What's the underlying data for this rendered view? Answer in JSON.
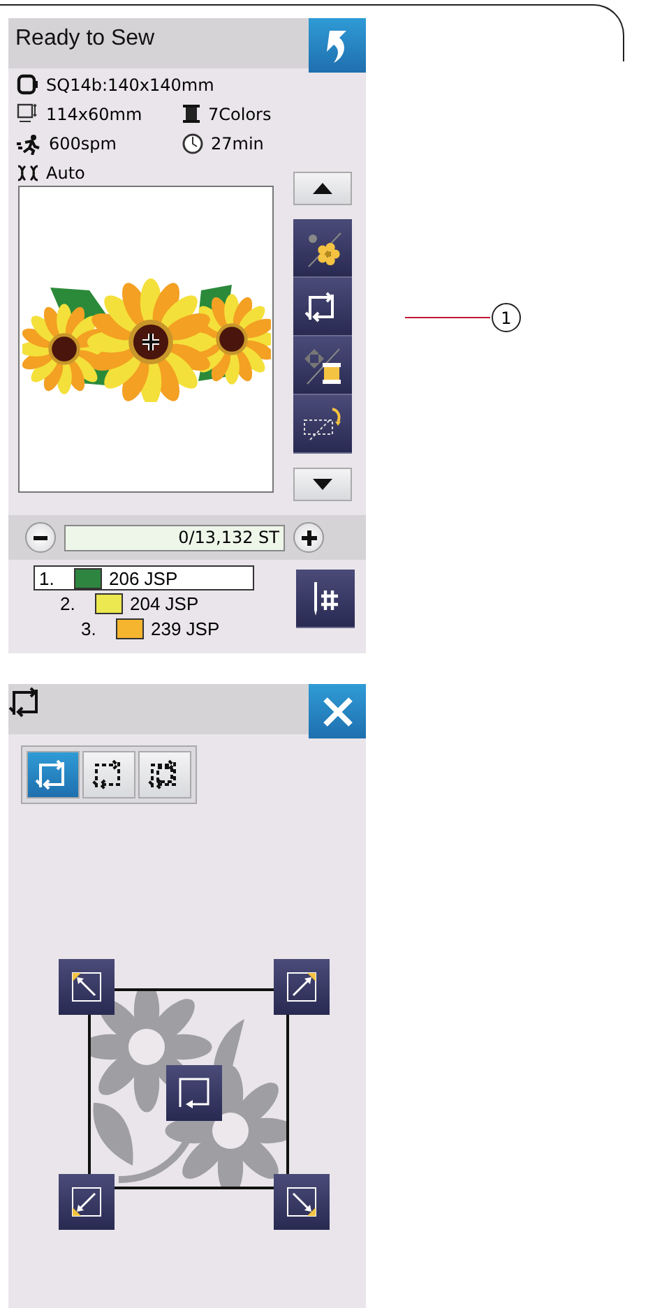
{
  "ready_screen": {
    "title": "Ready to Sew",
    "info": [
      {
        "kind": "hoop",
        "text": "SQ14b:140x140mm"
      },
      {
        "kind": "size",
        "text": "114x60mm"
      },
      {
        "kind": "spool",
        "text": "7Colors"
      },
      {
        "kind": "speed",
        "text": "600spm"
      },
      {
        "kind": "clock",
        "text": "27min"
      },
      {
        "kind": "tension",
        "text": "Auto"
      }
    ],
    "side_buttons": [
      {
        "kind": "up"
      },
      {
        "kind": "color-check"
      },
      {
        "kind": "trace"
      },
      {
        "kind": "jump"
      },
      {
        "kind": "rotate"
      },
      {
        "kind": "down"
      }
    ],
    "stitch_counter": {
      "value": "0/13,132 ST"
    },
    "colors": [
      {
        "number": "1.",
        "color": "#2e8540",
        "code": "206 JSP",
        "selected": true
      },
      {
        "number": "2.",
        "color": "#ece850",
        "code": "204 JSP",
        "selected": false
      },
      {
        "number": "3.",
        "color": "#f5b52e",
        "code": "239 JSP",
        "selected": false
      }
    ],
    "callout": {
      "label": "1"
    }
  },
  "trace_screen": {
    "modes": [
      {
        "kind": "outline",
        "selected": true
      },
      {
        "kind": "dashed",
        "selected": false
      },
      {
        "kind": "double-dashed",
        "selected": false
      }
    ]
  }
}
